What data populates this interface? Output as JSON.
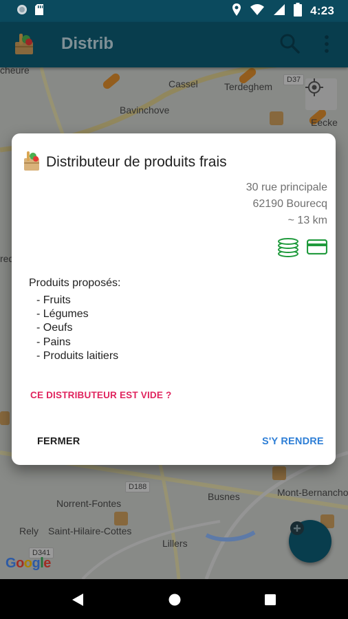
{
  "status_bar": {
    "time": "4:23"
  },
  "app_bar": {
    "title": "Distrib"
  },
  "map": {
    "labels": {
      "cassel": "Cassel",
      "terdeghem": "Terdeghem",
      "bavinchove": "Bavinchove",
      "eecke": "Eecke",
      "cheure": "cheure",
      "norrent_fontes": "Norrent-Fontes",
      "busnes": "Busnes",
      "mont_bernanchon": "Mont-Bernancho",
      "rely": "Rely",
      "saint_hilaire": "Saint-Hilaire-Cottes",
      "lillers": "Lillers",
      "edge_left": "red"
    },
    "roads": {
      "d37": "D37",
      "d188": "D188",
      "d341": "D341"
    },
    "google": [
      "G",
      "o",
      "o",
      "g",
      "l",
      "e"
    ]
  },
  "dialog": {
    "title": "Distributeur de produits frais",
    "address": {
      "street": "30 rue principale",
      "city": "62190 Bourecq",
      "distance": "~ 13 km"
    },
    "payment_icons": [
      "coins-icon",
      "credit-card-icon"
    ],
    "products_title": "Produits proposés:",
    "products": [
      "- Fruits",
      "- Légumes",
      "- Oeufs",
      "- Pains",
      "- Produits laitiers"
    ],
    "empty_link": "CE DISTRIBUTEUR EST VIDE ?",
    "close_label": "FERMER",
    "go_label": "S'Y RENDRE"
  },
  "colors": {
    "app_bar": "#0d5a72",
    "accent_pink": "#e0245e",
    "accent_blue": "#2f7fd6",
    "payment_green": "#1f9a3c"
  }
}
